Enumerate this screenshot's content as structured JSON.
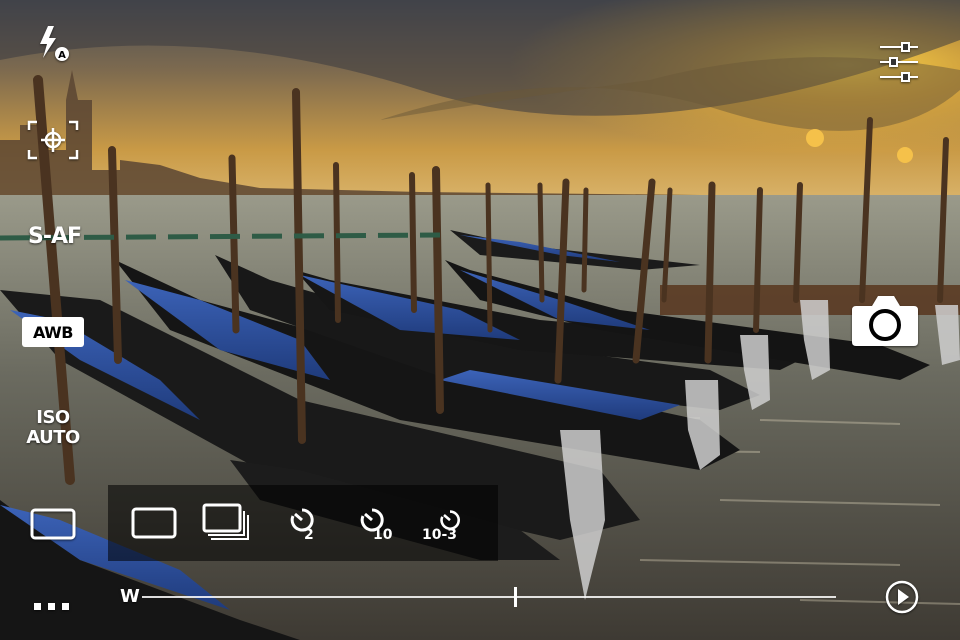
{
  "app": {
    "mode": "camera-viewfinder"
  },
  "colors": {
    "ui": "#ffffff",
    "panel": "rgba(0,0,0,0.55)",
    "sky_glow": "#f2b736"
  },
  "left_controls": {
    "flash": {
      "icon": "flash-auto-icon",
      "badge": "A"
    },
    "focus_point": {
      "icon": "focus-point-icon"
    },
    "focus_mode": {
      "label": "S-AF"
    },
    "white_balance": {
      "label": "AWB"
    },
    "iso": {
      "label_line1": "ISO",
      "label_line2": "AUTO"
    },
    "single_shot": {
      "icon": "single-frame-icon"
    },
    "more": {
      "icon": "more-icon"
    }
  },
  "right_controls": {
    "settings": {
      "icon": "sliders-icon"
    },
    "shutter": {
      "icon": "camera-shutter-icon"
    },
    "play": {
      "icon": "play-icon"
    }
  },
  "drive_panel": {
    "single": {
      "icon": "single-frame-icon"
    },
    "sequential": {
      "icon": "sequential-frames-icon"
    },
    "timers": [
      {
        "icon": "self-timer-icon",
        "label": "2"
      },
      {
        "icon": "self-timer-icon",
        "label": "10"
      },
      {
        "icon": "self-timer-icon",
        "label": "10-3"
      }
    ]
  },
  "zoom": {
    "label": "W"
  }
}
